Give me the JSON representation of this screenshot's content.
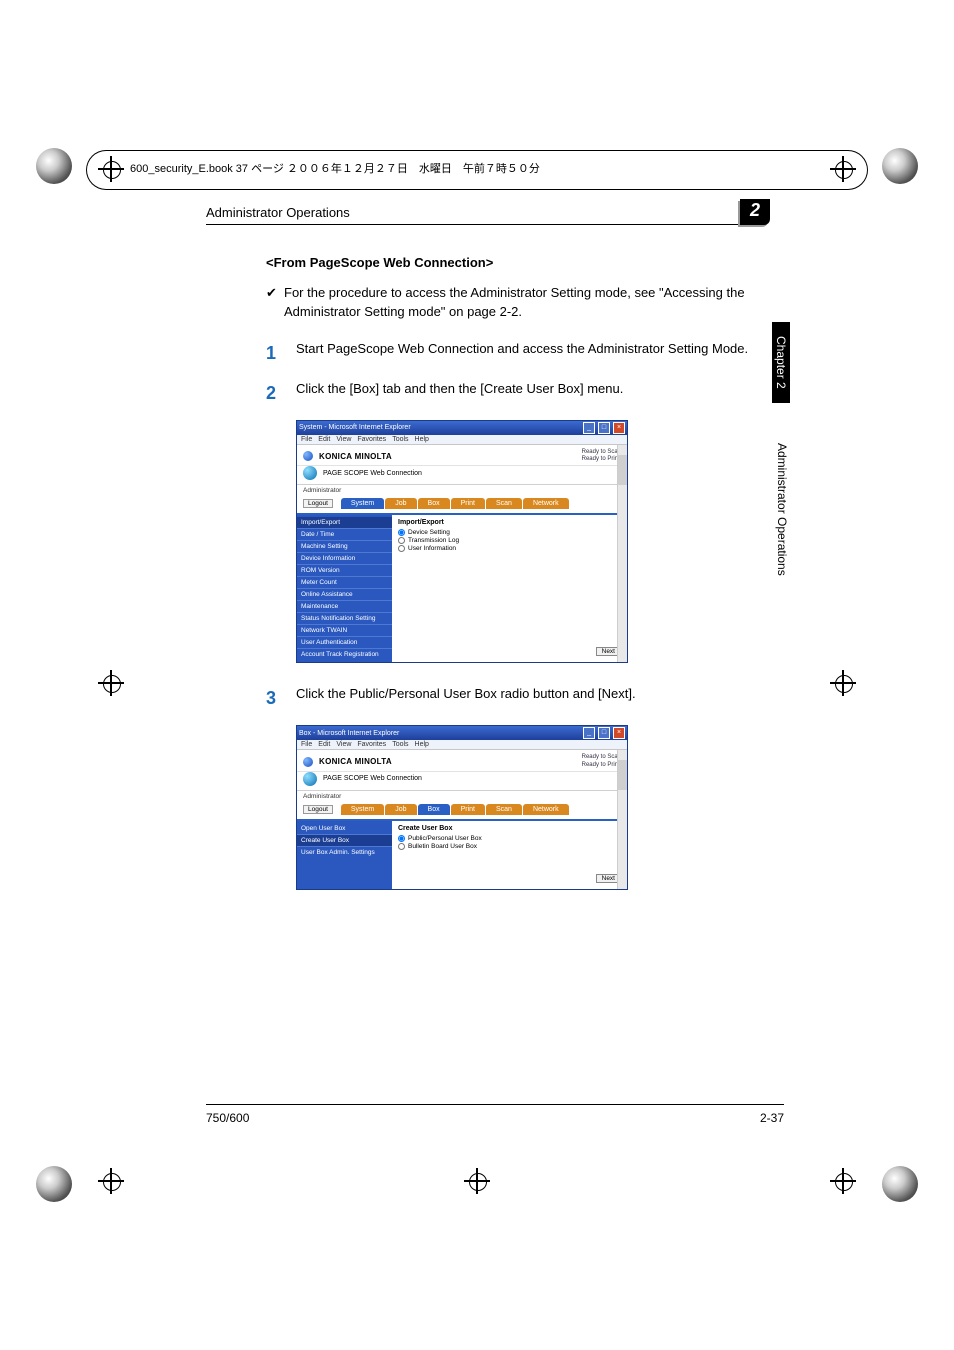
{
  "book_header": "600_security_E.book  37 ページ  ２００６年１２月２７日　水曜日　午前７時５０分",
  "running_head": "Administrator Operations",
  "chapter_num": "2",
  "sidetab_black": "Chapter 2",
  "sidetab_gray": "Administrator Operations",
  "h3": "<From PageScope Web Connection>",
  "bullet_mark": "✔",
  "bullet_text": "For the procedure to access the Administrator Setting mode, see \"Accessing the Administrator Setting mode\" on page 2-2.",
  "step1_num": "1",
  "step1_text": "Start PageScope Web Connection and access the Administrator Setting Mode.",
  "step2_num": "2",
  "step2_text": "Click the [Box] tab and then the [Create User Box] menu.",
  "step3_num": "3",
  "step3_text": "Click the Public/Personal User Box radio button and [Next].",
  "footer_left": "750/600",
  "footer_right": "2-37",
  "ie": {
    "title1": "System - Microsoft Internet Explorer",
    "title2": "Box - Microsoft Internet Explorer",
    "menus": [
      "File",
      "Edit",
      "View",
      "Favorites",
      "Tools",
      "Help"
    ],
    "brand": "KONICA MINOLTA",
    "subbrand": "PAGE SCOPE Web Connection",
    "ready1": "Ready to Scan",
    "ready2": "Ready to Print",
    "admin_label": "Administrator",
    "logout": "Logout",
    "tabs": {
      "system": "System",
      "job": "Job",
      "box": "Box",
      "print": "Print",
      "scan": "Scan",
      "network": "Network"
    },
    "next_btn": "Next"
  },
  "shot1": {
    "side": [
      "Import/Export",
      "Date / Time",
      "Machine Setting",
      "Device Information",
      "ROM Version",
      "Meter Count",
      "Online Assistance",
      "Maintenance",
      "Status Notification Setting",
      "Network TWAIN",
      "User Authentication",
      "Account Track Registration"
    ],
    "panel_title": "Import/Export",
    "opts": [
      "Device Setting",
      "Transmission Log",
      "User Information"
    ]
  },
  "shot2": {
    "side": [
      "Open User Box",
      "Create User Box",
      "User Box Admin. Settings"
    ],
    "panel_title": "Create User Box",
    "opts": [
      "Public/Personal User Box",
      "Bulletin Board User Box"
    ]
  }
}
